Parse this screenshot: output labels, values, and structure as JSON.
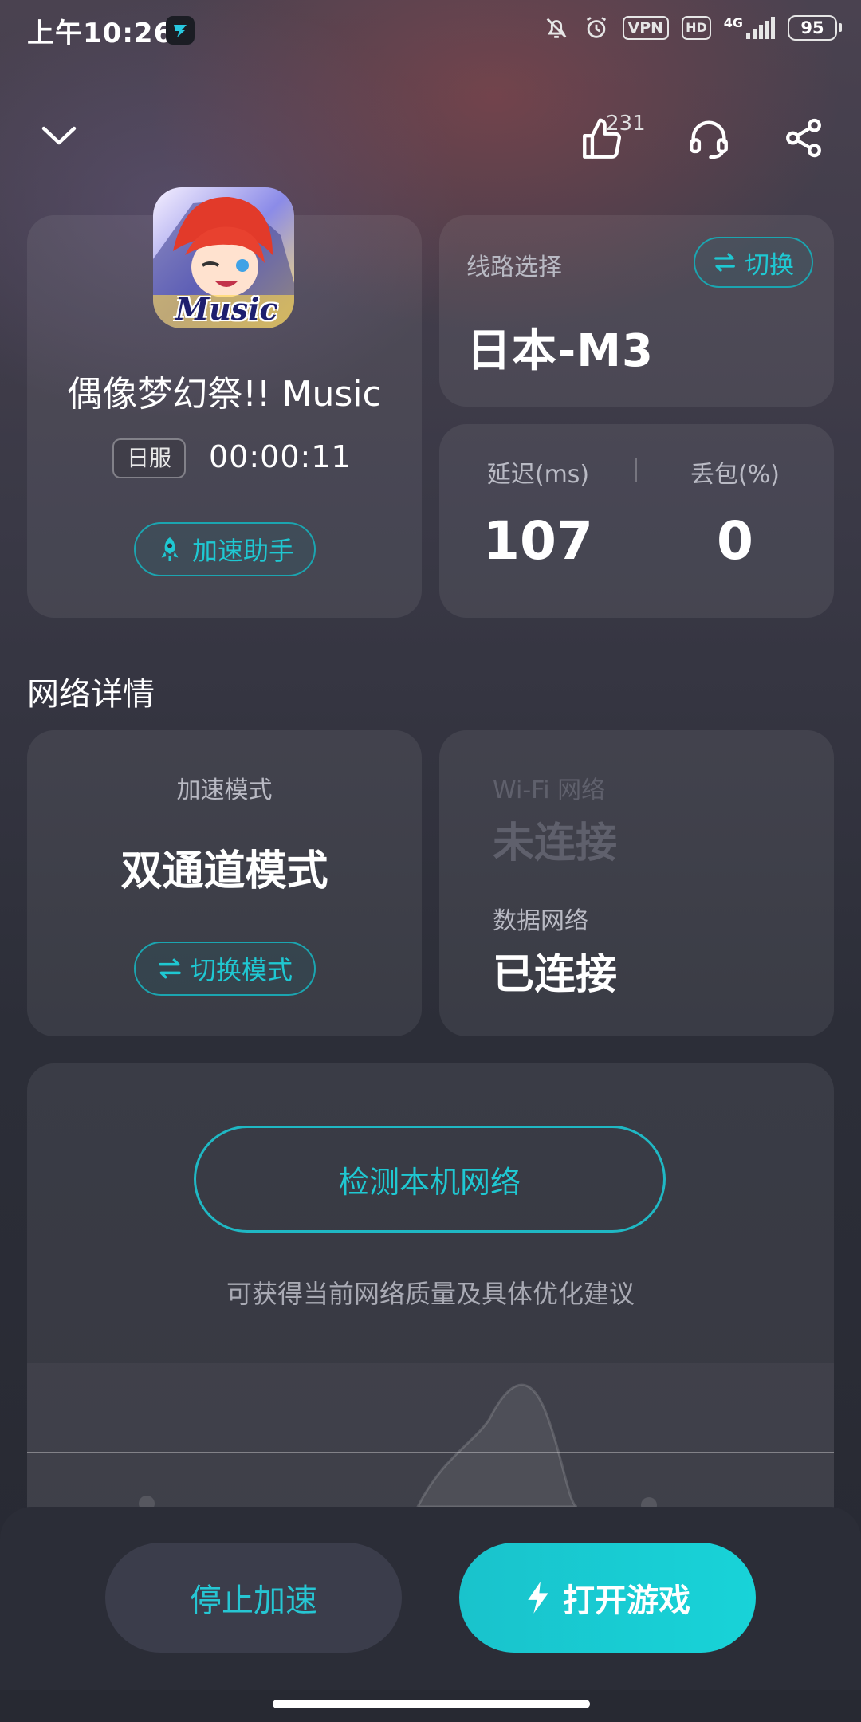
{
  "status": {
    "time": "上午10:26",
    "vpn": "VPN",
    "hd": "HD",
    "network": "4G",
    "battery": "95"
  },
  "top": {
    "likes": "231"
  },
  "game": {
    "title": "偶像梦幻祭!! Music",
    "icon_text": "Music",
    "server": "日服",
    "timer": "00:00:11",
    "assistant_label": "加速助手"
  },
  "route": {
    "label": "线路选择",
    "switch_label": "切换",
    "value": "日本-M3"
  },
  "stats": {
    "latency_label": "延迟(ms)",
    "latency_value": "107",
    "loss_label": "丢包(%)",
    "loss_value": "0"
  },
  "network": {
    "section_title": "网络详情",
    "mode_label": "加速模式",
    "mode_value": "双通道模式",
    "switch_mode_label": "切换模式",
    "wifi_label": "Wi-Fi 网络",
    "wifi_status": "未连接",
    "data_label": "数据网络",
    "data_status": "已连接"
  },
  "check": {
    "button_label": "检测本机网络",
    "hint": "可获得当前网络质量及具体优化建议"
  },
  "bottom": {
    "stop_label": "停止加速",
    "open_label": "打开游戏"
  },
  "colors": {
    "accent": "#1fc8d2",
    "background": "#2c2e38"
  }
}
